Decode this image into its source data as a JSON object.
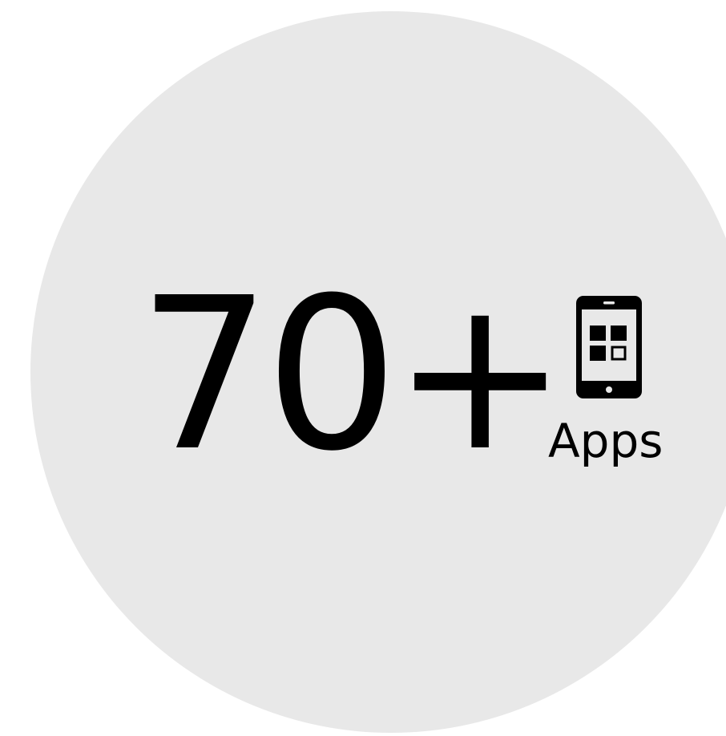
{
  "badge": {
    "number": "70+",
    "label": "Apps",
    "icon": "smartphone-apps-icon"
  },
  "colors": {
    "background": "#ffffff",
    "circle": "#e8e8e8",
    "foreground": "#000000"
  }
}
